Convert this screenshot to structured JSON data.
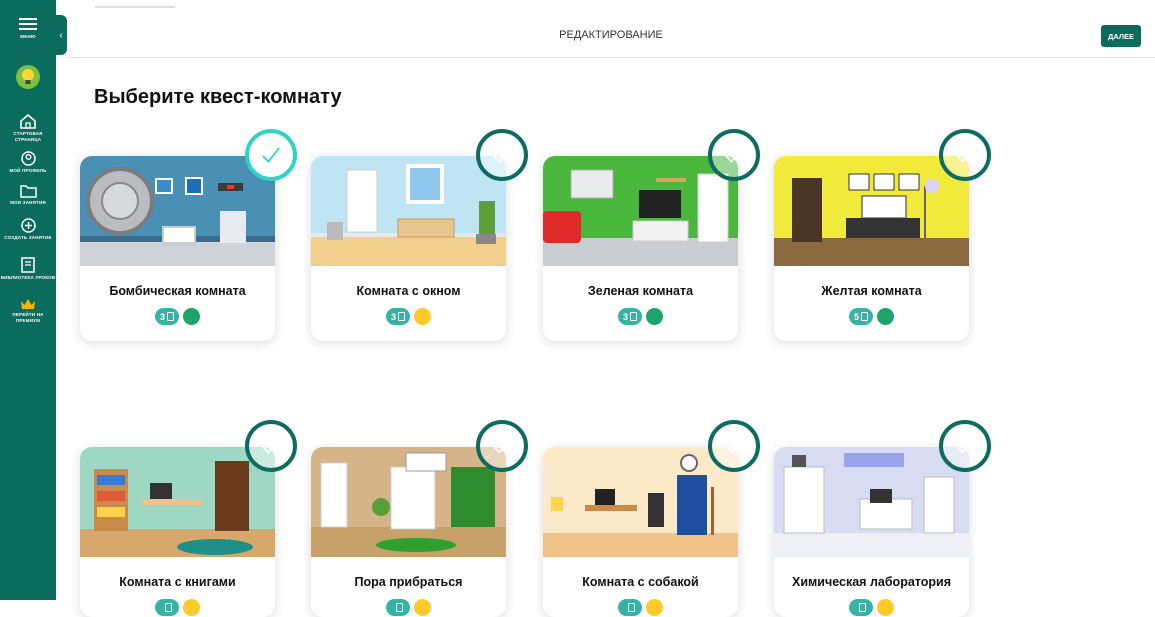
{
  "sidebar": {
    "menu_label": "МЕНЮ",
    "items": [
      {
        "label": "СТАРТОВАЯ СТРАНИЦА",
        "icon": "home-icon"
      },
      {
        "label": "МОЙ ПРОФИЛЬ",
        "icon": "profile-icon"
      },
      {
        "label": "МОИ ЗАНЯТИЯ",
        "icon": "folder-icon"
      },
      {
        "label": "СОЗДАТЬ ЗАНЯТИЕ",
        "icon": "plus-icon"
      },
      {
        "label": "БИБЛИОТЕКА УРОКОВ",
        "icon": "library-icon"
      },
      {
        "label": "ПЕРЕЙТИ НА ПРЕМИУМ",
        "icon": "crown-icon"
      }
    ]
  },
  "header": {
    "title": "РЕДАКТИРОВАНИЕ",
    "next_label": "ДАЛЕЕ"
  },
  "main": {
    "title": "Выберите квест-комнату",
    "rooms": [
      {
        "name": "Бомбическая комната",
        "count": "3",
        "dot": "#1ea36b",
        "selected": true
      },
      {
        "name": "Комната с окном",
        "count": "3",
        "dot": "#ffc928",
        "selected": false
      },
      {
        "name": "Зеленая комната",
        "count": "3",
        "dot": "#1ea36b",
        "selected": false
      },
      {
        "name": "Желтая комната",
        "count": "5",
        "dot": "#1ea36b",
        "selected": false
      },
      {
        "name": "Комната с книгами",
        "count": "",
        "dot": "#ffc928",
        "selected": false
      },
      {
        "name": "Пора прибраться",
        "count": "",
        "dot": "#ffc928",
        "selected": false
      },
      {
        "name": "Комната с собакой",
        "count": "",
        "dot": "#ffc928",
        "selected": false
      },
      {
        "name": "Химическая лаборатория",
        "count": "",
        "dot": "#ffc928",
        "selected": false
      }
    ]
  },
  "colors": {
    "primary": "#0b6b5c",
    "accent": "#37b3a6",
    "selected_ring": "#2fd3c6"
  }
}
